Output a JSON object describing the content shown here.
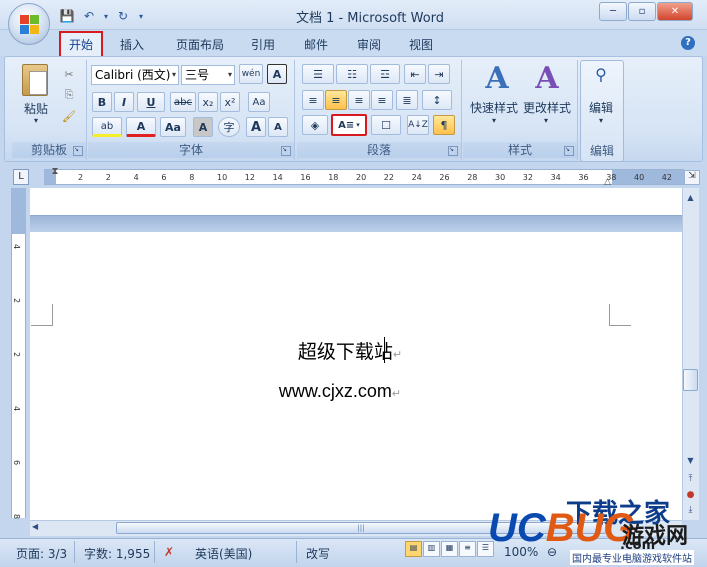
{
  "window": {
    "title": "文档 1 - Microsoft Word",
    "minimize": "─",
    "maximize": "▫",
    "close": "✕"
  },
  "qat": {
    "save": "💾",
    "undo": "↶",
    "undo_arrow": "▾",
    "redo": "↻",
    "customize": "▾"
  },
  "tabs": [
    "开始",
    "插入",
    "页面布局",
    "引用",
    "邮件",
    "审阅",
    "视图"
  ],
  "active_tab": "开始",
  "help": "?",
  "ribbon": {
    "clipboard": {
      "label": "剪贴板",
      "paste": "粘贴",
      "paste_arrow": "▾",
      "cut": "✂",
      "copy": "⎘",
      "format_painter": "🖌"
    },
    "font": {
      "label": "字体",
      "font_name": "Calibri (西文)",
      "font_size": "三号",
      "phonetic": "wén",
      "border_char": "A",
      "bold": "B",
      "italic": "I",
      "underline": "U",
      "strike": "abc",
      "subscript": "x₂",
      "superscript": "x²",
      "clear": "Aa",
      "highlight": "ab",
      "font_color": "A",
      "change_case": "Aa",
      "shade": "A",
      "enclose": "字",
      "grow": "A",
      "shrink": "A"
    },
    "paragraph": {
      "label": "段落",
      "bullets": "☰",
      "numbering": "☷",
      "multilevel": "☲",
      "decrease_indent": "⇤",
      "increase_indent": "⇥",
      "align_left": "≡",
      "center": "≡",
      "align_right": "≡",
      "justify": "≡",
      "distributed": "≣",
      "line_spacing": "↕",
      "shading": "◈",
      "border": "☐",
      "sort": "A↓Z",
      "show_marks": "¶"
    },
    "styles": {
      "label": "样式",
      "quick_styles": "快速样式",
      "change_styles": "更改样式"
    },
    "editing": {
      "label": "编辑",
      "button": "编辑"
    }
  },
  "ruler": {
    "corner": "L",
    "ticks": [
      "2",
      "2",
      "4",
      "6",
      "8",
      "10",
      "12",
      "14",
      "16",
      "18",
      "20",
      "22",
      "24",
      "26",
      "28",
      "30",
      "32",
      "34",
      "36",
      "38",
      "40",
      "42",
      "44"
    ],
    "vticks": [
      "4",
      "2",
      "2",
      "4",
      "6",
      "8"
    ]
  },
  "document": {
    "line1": "超级下载站",
    "line2": "www.cjxz.com",
    "para_mark": "↵"
  },
  "status": {
    "page": "页面: 3/3",
    "words": "字数: 1,955",
    "lang": "英语(美国)",
    "mode": "改写",
    "zoom": "100%",
    "zoom_out": "⊖"
  },
  "watermark": {
    "top": "下载之家",
    "brand_u": "UC",
    "brand_b": "BUG",
    "game": "游戏网",
    "com": ".com",
    "sub": "国内最专业电脑游戏软件站"
  }
}
